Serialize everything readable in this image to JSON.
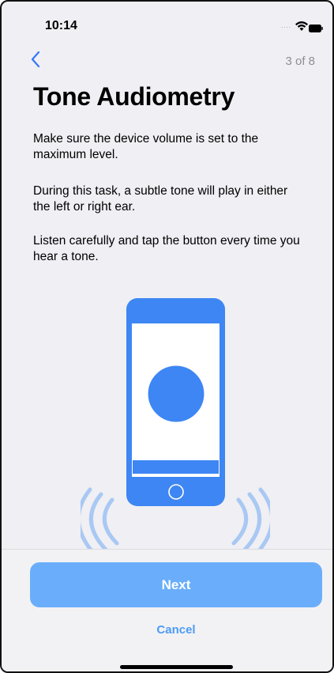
{
  "status_bar": {
    "time": "10:14",
    "signal_dots": "....",
    "wifi_icon": "wifi-icon",
    "battery_icon": "battery-icon"
  },
  "nav": {
    "back_icon": "chevron-left-icon",
    "step": "3 of 8"
  },
  "content": {
    "title": "Tone Audiometry",
    "paragraphs": [
      "Make sure the device volume is set to the maximum level.",
      "During this task, a subtle tone will play in either the left or right ear.",
      "Listen carefully and tap the button every time you hear a tone."
    ],
    "illustration": "phone-tone-button-illustration"
  },
  "footer": {
    "next_label": "Next",
    "cancel_label": "Cancel"
  },
  "colors": {
    "accent": "#3478f6",
    "next_button": "#6aaefb",
    "cancel_text": "#4d9bf5",
    "background": "#efeff4",
    "sound_waves": "#a9c8f3"
  }
}
